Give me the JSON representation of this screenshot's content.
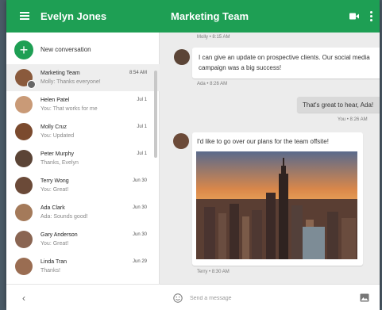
{
  "header": {
    "user_name": "Evelyn Jones",
    "chat_title": "Marketing Team",
    "bg_color": "#1e9f54"
  },
  "sidebar": {
    "new_conversation_label": "New conversation",
    "conversations": [
      {
        "name": "Marketing Team",
        "preview": "Molly: Thanks everyone!",
        "date": "8:54 AM",
        "selected": true,
        "avatar_color": "#8a5a3c"
      },
      {
        "name": "Helen Patel",
        "preview": "You: That works for me",
        "date": "Jul 1",
        "avatar_color": "#c99a77"
      },
      {
        "name": "Molly Cruz",
        "preview": "You: Updated",
        "date": "Jul 1",
        "avatar_color": "#7b4a2e"
      },
      {
        "name": "Peter Murphy",
        "preview": "Thanks, Evelyn",
        "date": "Jul 1",
        "avatar_color": "#5b4436"
      },
      {
        "name": "Terry Wong",
        "preview": "You: Great!",
        "date": "Jun 30",
        "avatar_color": "#6b4a38"
      },
      {
        "name": "Ada Clark",
        "preview": "Ada: Sounds good!",
        "date": "Jun 30",
        "avatar_color": "#a47a5a"
      },
      {
        "name": "Gary Anderson",
        "preview": "You: Great!",
        "date": "Jun 30",
        "avatar_color": "#8a6552"
      },
      {
        "name": "Linda Tran",
        "preview": "Thanks!",
        "date": "Jun 29",
        "avatar_color": "#9a6d52"
      }
    ]
  },
  "chat": {
    "messages": [
      {
        "meta": "Molly • 8:15 AM"
      },
      {
        "text": "I can give an update on prospective clients. Our social media campaign was a big success!",
        "meta": "Ada • 8:26 AM"
      },
      {
        "text": "That's great to hear, Ada!",
        "meta": "You • 8:26 AM"
      },
      {
        "text": "I'd like to go over our plans for the team offsite!",
        "meta": "Terry • 8:30 AM"
      }
    ],
    "composer_placeholder": "Send a message"
  }
}
